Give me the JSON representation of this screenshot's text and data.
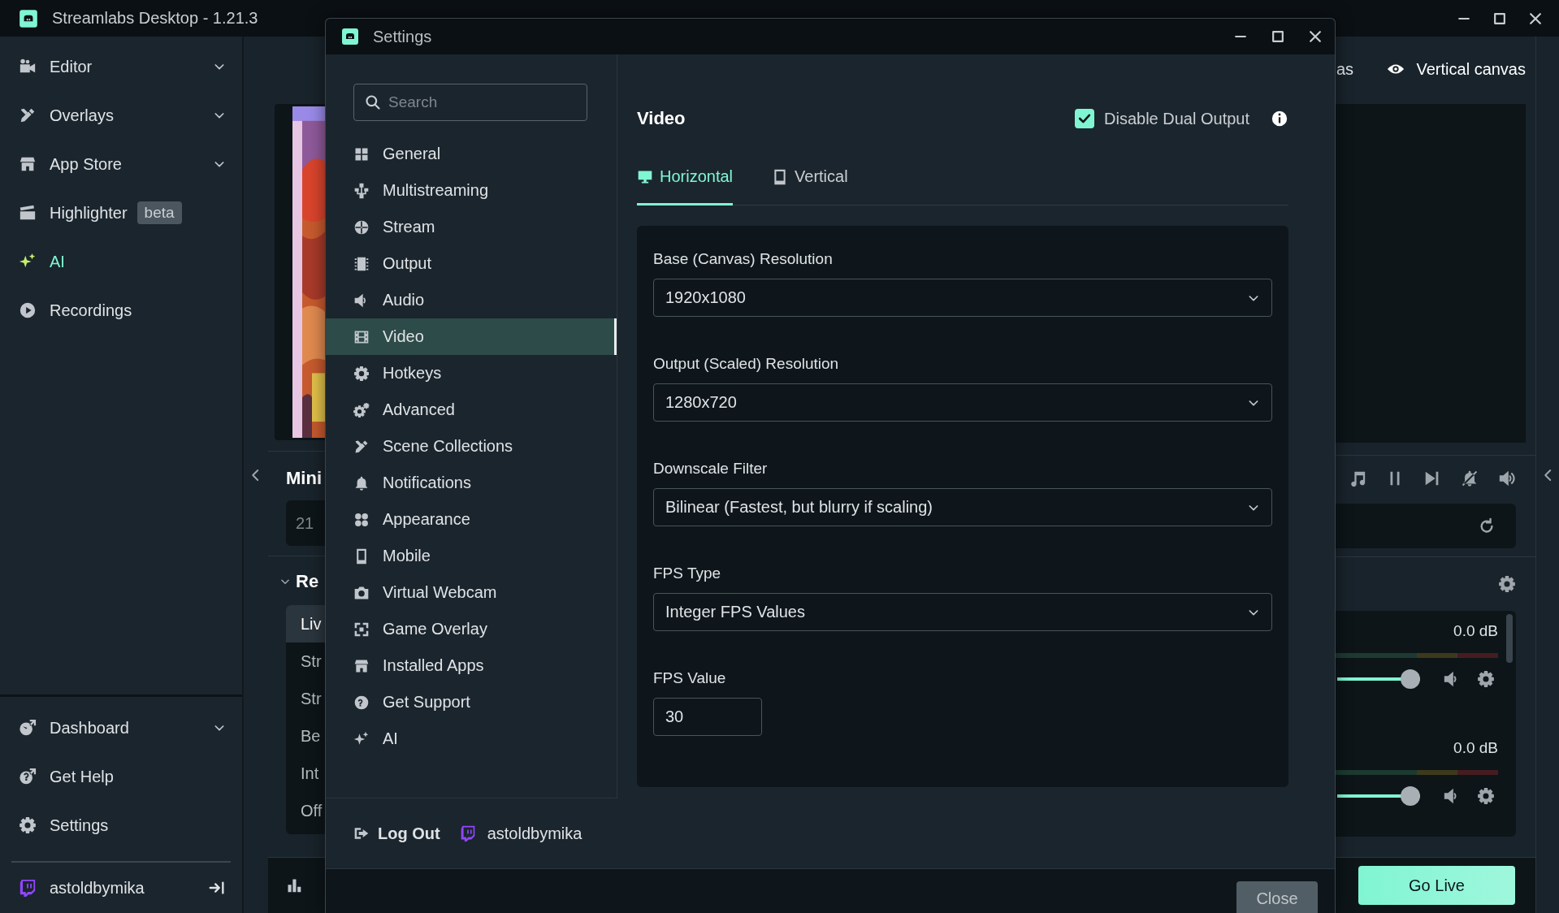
{
  "app_window": {
    "title": "Streamlabs Desktop - 1.21.3"
  },
  "nav": {
    "items": [
      {
        "label": "Editor",
        "expandable": true,
        "accent": false
      },
      {
        "label": "Overlays",
        "expandable": true,
        "accent": false
      },
      {
        "label": "App Store",
        "expandable": true,
        "accent": false
      },
      {
        "label": "Highlighter",
        "expandable": false,
        "accent": false,
        "badge": "beta"
      },
      {
        "label": "AI",
        "expandable": false,
        "accent": true
      },
      {
        "label": "Recordings",
        "expandable": false,
        "accent": false
      }
    ],
    "bottom_items": [
      {
        "label": "Dashboard",
        "expandable": true
      },
      {
        "label": "Get Help",
        "expandable": false
      },
      {
        "label": "Settings",
        "expandable": false
      }
    ],
    "account": {
      "name": "astoldbymika"
    }
  },
  "background": {
    "left": {
      "section_title": "Mini",
      "field_value": "21",
      "collapsible_title": "Re",
      "list_items": [
        {
          "label": "Liv",
          "selected": true
        },
        {
          "label": "Str",
          "selected": false
        },
        {
          "label": "Str",
          "selected": false
        },
        {
          "label": "Be",
          "selected": false
        },
        {
          "label": "Int",
          "selected": false
        },
        {
          "label": "Off",
          "selected": false
        }
      ]
    },
    "right": {
      "canvas_partial": "as",
      "canvas_toggle": "Vertical canvas",
      "mixer": [
        {
          "reading": "0.0 dB",
          "level": 0.94
        },
        {
          "reading": "0.0 dB",
          "level": 0.94
        }
      ],
      "go_live": "Go Live"
    }
  },
  "settings": {
    "title": "Settings",
    "search": {
      "placeholder": "Search"
    },
    "categories": [
      {
        "label": "General",
        "selected": false
      },
      {
        "label": "Multistreaming",
        "selected": false
      },
      {
        "label": "Stream",
        "selected": false
      },
      {
        "label": "Output",
        "selected": false
      },
      {
        "label": "Audio",
        "selected": false
      },
      {
        "label": "Video",
        "selected": true
      },
      {
        "label": "Hotkeys",
        "selected": false
      },
      {
        "label": "Advanced",
        "selected": false
      },
      {
        "label": "Scene Collections",
        "selected": false
      },
      {
        "label": "Notifications",
        "selected": false
      },
      {
        "label": "Appearance",
        "selected": false
      },
      {
        "label": "Mobile",
        "selected": false
      },
      {
        "label": "Virtual Webcam",
        "selected": false
      },
      {
        "label": "Game Overlay",
        "selected": false
      },
      {
        "label": "Installed Apps",
        "selected": false
      },
      {
        "label": "Get Support",
        "selected": false
      },
      {
        "label": "AI",
        "selected": false
      }
    ],
    "account": {
      "logout": "Log Out",
      "name": "astoldbymika"
    },
    "page": {
      "title": "Video",
      "dual_output": {
        "label": "Disable Dual Output",
        "checked": true
      },
      "tabs": [
        {
          "label": "Horizontal",
          "selected": true
        },
        {
          "label": "Vertical",
          "selected": false
        }
      ],
      "fields": [
        {
          "kind": "select",
          "label": "Base (Canvas) Resolution",
          "value": "1920x1080"
        },
        {
          "kind": "select",
          "label": "Output (Scaled) Resolution",
          "value": "1280x720"
        },
        {
          "kind": "select",
          "label": "Downscale Filter",
          "value": "Bilinear (Fastest, but blurry if scaling)"
        },
        {
          "kind": "select",
          "label": "FPS Type",
          "value": "Integer FPS Values"
        },
        {
          "kind": "input",
          "label": "FPS Value",
          "value": "30"
        }
      ]
    },
    "close_button": "Close"
  }
}
